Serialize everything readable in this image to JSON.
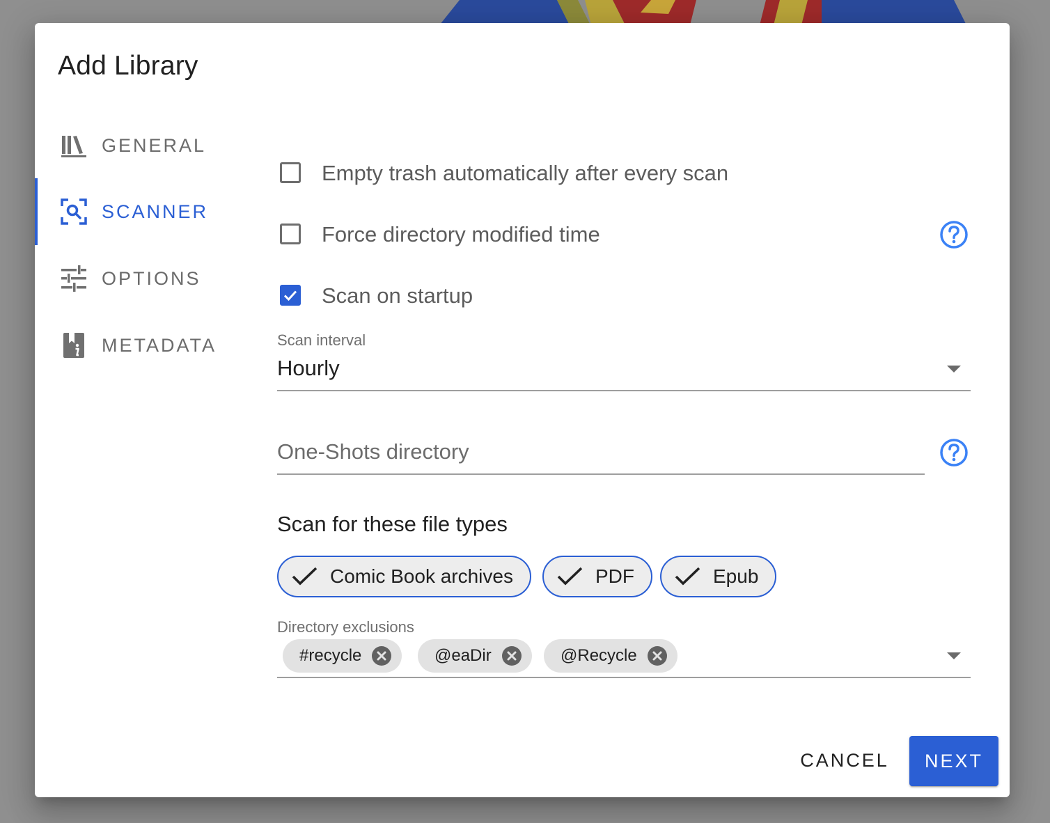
{
  "colors": {
    "accent": "#2b5fd4",
    "scrim": "#8f8f8f",
    "surface": "#ffffff"
  },
  "dialog": {
    "title": "Add Library"
  },
  "tabs": [
    {
      "label": "GENERAL",
      "icon": "bookshelf-icon",
      "active": false
    },
    {
      "label": "SCANNER",
      "icon": "scan-search-icon",
      "active": true
    },
    {
      "label": "OPTIONS",
      "icon": "tune-sliders-icon",
      "active": false
    },
    {
      "label": "METADATA",
      "icon": "book-info-icon",
      "active": false
    }
  ],
  "scanner": {
    "empty_trash": {
      "label": "Empty trash automatically after every scan",
      "checked": false
    },
    "force_modified": {
      "label": "Force directory modified time",
      "checked": false
    },
    "scan_startup": {
      "label": "Scan on startup",
      "checked": true
    },
    "scan_interval": {
      "label": "Scan interval",
      "value": "Hourly"
    },
    "oneshots": {
      "placeholder": "One-Shots directory",
      "value": ""
    },
    "file_types": {
      "heading": "Scan for these file types",
      "chips": [
        {
          "label": "Comic Book archives",
          "selected": true
        },
        {
          "label": "PDF",
          "selected": true
        },
        {
          "label": "Epub",
          "selected": true
        }
      ]
    },
    "exclusions": {
      "label": "Directory exclusions",
      "chips": [
        "#recycle",
        "@eaDir",
        "@Recycle"
      ]
    }
  },
  "actions": {
    "cancel": "CANCEL",
    "next": "NEXT"
  }
}
